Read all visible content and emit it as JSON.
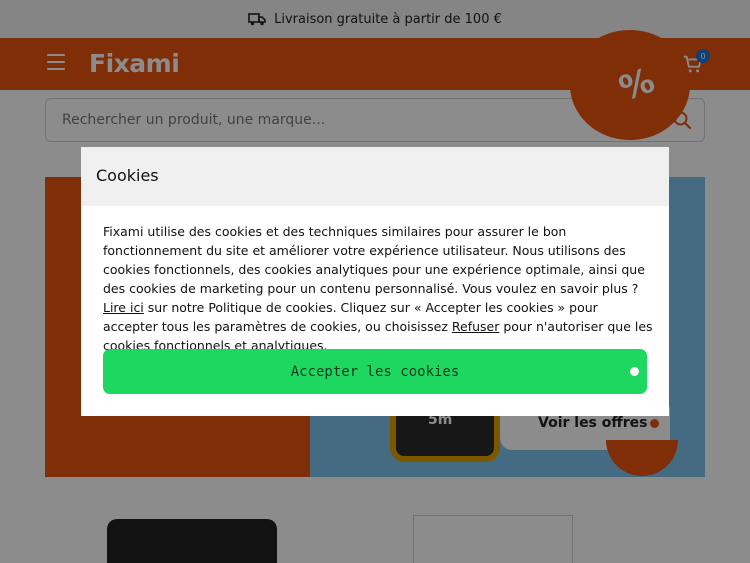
{
  "topbar": {
    "text": "Livraison gratuite à partir de 100 €",
    "icon": "delivery-truck-icon"
  },
  "header": {
    "logo": "Fixami",
    "cart_count": "0",
    "icons": [
      "menu-icon",
      "heart-icon",
      "user-icon",
      "cart-icon"
    ]
  },
  "search": {
    "placeholder": "Rechercher un produit, une marque..."
  },
  "hero": {
    "promo_symbol": "%",
    "tape_label": "5m",
    "offers_label": "Voir les offres"
  },
  "cookie": {
    "title": "Cookies",
    "body_part1": "Fixami utilise des cookies et des techniques similaires pour assurer le bon fonctionnement du site et améliorer votre expérience utilisateur. Nous utilisons des cookies fonctionnels, des cookies analytiques pour une expérience optimale, ainsi que des cookies de marketing pour un contenu personnalisé. Vous voulez en savoir plus ? ",
    "link_read": "Lire ici",
    "body_part2": " sur notre Politique de cookies. Cliquez sur « Accepter les cookies » pour accepter tous les paramètres de cookies, ou choisissez ",
    "link_refuse": "Refuser",
    "body_part3": " pour n'autoriser que les cookies fonctionnels et analytiques.",
    "accept_label": "Accepter les cookies"
  },
  "colors": {
    "brand": "#e8540d",
    "accept": "#1ed760",
    "badge": "#1976d2"
  }
}
